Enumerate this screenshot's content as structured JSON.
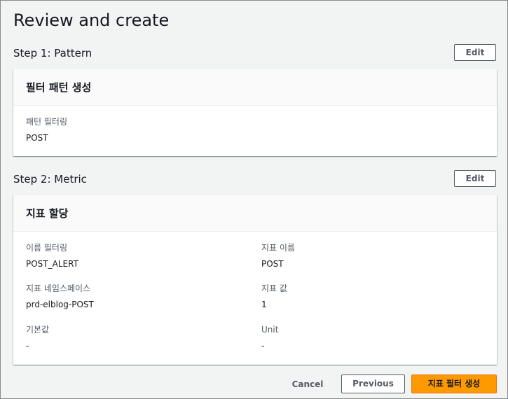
{
  "page": {
    "title": "Review and create"
  },
  "step1": {
    "header": "Step 1: Pattern",
    "edit_label": "Edit",
    "card_title": "필터 패턴 생성",
    "fields": [
      {
        "label": "패턴 필터링",
        "value": "POST"
      }
    ]
  },
  "step2": {
    "header": "Step 2: Metric",
    "edit_label": "Edit",
    "card_title": "지표 할당",
    "fields": [
      {
        "label": "이름 필터링",
        "value": "POST_ALERT"
      },
      {
        "label": "지표 이름",
        "value": "POST"
      },
      {
        "label": "지표 네임스페이스",
        "value": "prd-elblog-POST"
      },
      {
        "label": "지표 값",
        "value": "1"
      },
      {
        "label": "기본값",
        "value": "-"
      },
      {
        "label": "Unit",
        "value": "-"
      }
    ]
  },
  "footer": {
    "cancel_label": "Cancel",
    "previous_label": "Previous",
    "create_label": "지표 필터 생성"
  },
  "colors": {
    "primary_button": "#ff9900",
    "primary_border": "#ec7211",
    "secondary_text": "#545b64",
    "background": "#f2f3f3"
  }
}
